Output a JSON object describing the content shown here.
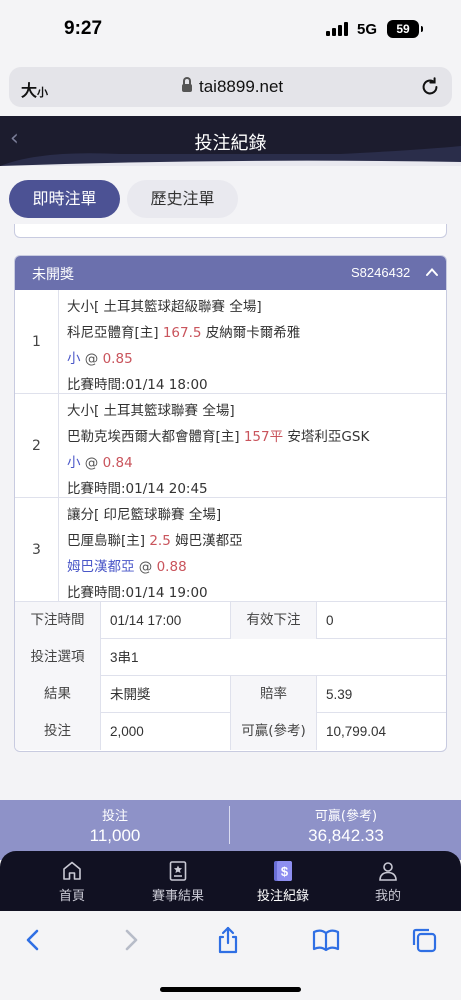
{
  "status_bar": {
    "time": "9:27",
    "network": "5G",
    "battery": "59"
  },
  "browser": {
    "text_size_label": "大",
    "text_size_small": "小",
    "url": "tai8899.net"
  },
  "header": {
    "title": "投注紀錄"
  },
  "tabs": [
    {
      "label": "即時注單",
      "active": true
    },
    {
      "label": "歷史注單",
      "active": false
    }
  ],
  "order": {
    "status": "未開獎",
    "order_id": "S8246432",
    "legs": [
      {
        "index": "1",
        "market": "大小",
        "league": "[ 土耳其籃球超級聯賽 全場]",
        "home": "科尼亞體育[主]",
        "line": "167.5",
        "away": "皮納爾卡爾希雅",
        "pick": "小",
        "at": "@",
        "odds": "0.85",
        "time": "比賽時間:01/14 18:00"
      },
      {
        "index": "2",
        "market": "大小",
        "league": "[ 土耳其籃球聯賽 全場]",
        "home": "巴勒克埃西爾大都會體育[主]",
        "line": "157平",
        "away": "安塔利亞GSK",
        "pick": "小",
        "at": "@",
        "odds": "0.84",
        "time": "比賽時間:01/14 20:45"
      },
      {
        "index": "3",
        "market": "讓分",
        "league": "[ 印尼籃球聯賽 全場]",
        "home": "巴厘島聯[主]",
        "line": "2.5",
        "away": "姆巴漢都亞",
        "pick": "姆巴漢都亞",
        "at": "@",
        "odds": "0.88",
        "time": "比賽時間:01/14 19:00"
      }
    ],
    "info": {
      "bet_time_label": "下注時間",
      "bet_time": "01/14 17:00",
      "valid_label": "有效下注",
      "valid": "0",
      "option_label": "投注選項",
      "option": "3串1",
      "result_label": "結果",
      "result": "未開獎",
      "odds_label": "賠率",
      "odds": "5.39",
      "stake_label": "投注",
      "stake": "2,000",
      "win_label": "可贏(參考)",
      "win": "10,799.04"
    }
  },
  "summary": {
    "stake_label": "投注",
    "stake": "11,000",
    "win_label": "可贏(參考)",
    "win": "36,842.33"
  },
  "bottom_nav": [
    {
      "label": "首頁",
      "icon": "home-icon",
      "active": false
    },
    {
      "label": "賽事結果",
      "icon": "results-icon",
      "active": false
    },
    {
      "label": "投注紀錄",
      "icon": "bet-record-icon",
      "active": true
    },
    {
      "label": "我的",
      "icon": "user-icon",
      "active": false
    }
  ],
  "colors": {
    "accent": "#4c5294",
    "header_bg": "#1c1c2e",
    "card_head": "#6b70ad",
    "highlight_red": "#c9545c",
    "pick_blue": "#4a57c8"
  }
}
